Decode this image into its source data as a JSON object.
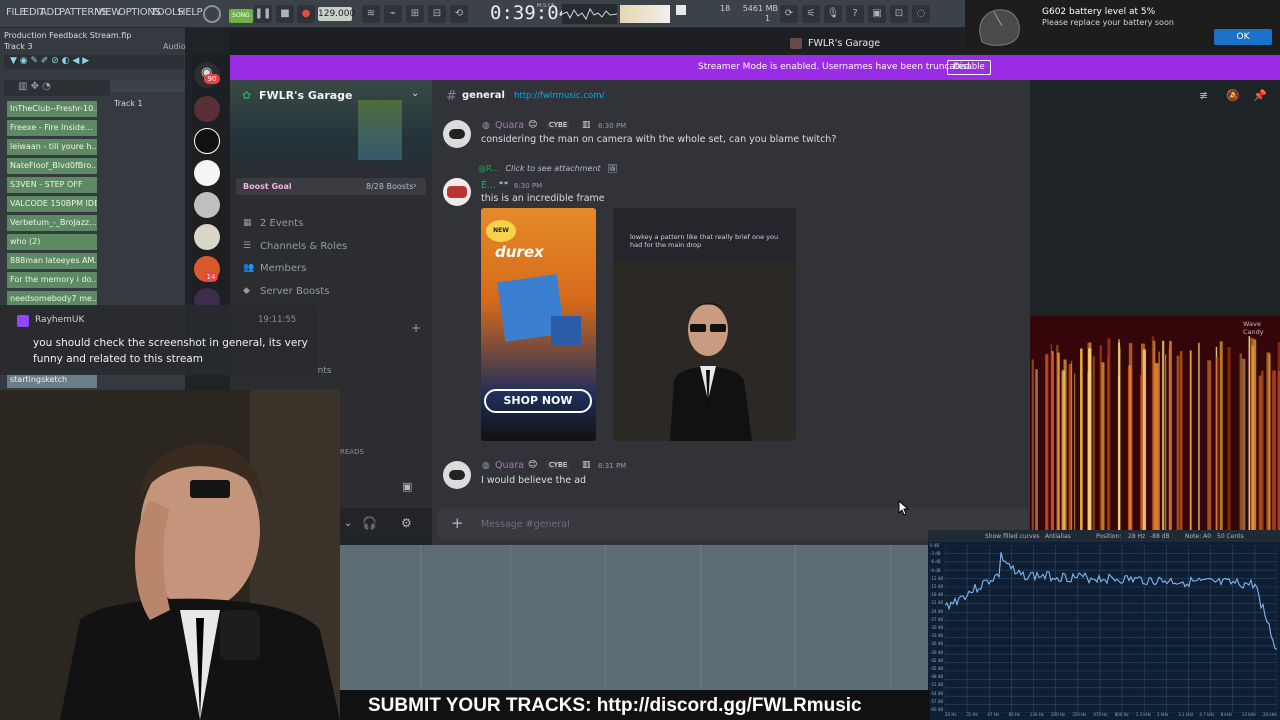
{
  "fl": {
    "menu": [
      "FILE",
      "EDIT",
      "ADD",
      "PATTERNS",
      "VIEW",
      "OPTIONS",
      "TOOLS",
      "HELP"
    ],
    "song_label": "SONG",
    "bpm": "129.000",
    "time": "0:39:04",
    "time_label": "M:S:CS",
    "cpu": "18",
    "mem": "5461 MB",
    "mem_sub": "1",
    "project_title": "Production Feedback Stream.flp",
    "track_label": "Track 3",
    "audio_label": "Audio",
    "playlist_track": "Track 1",
    "browser_items": [
      "InTheClub--Freshr-10...",
      "Freexe - Fire Inside...",
      "leiwaan - till youre h...",
      "NateFloof_Blvd0fBro...",
      "S3VEN - STEP OFF",
      "VALCODE 150BPM IDB...",
      "Verbetum_-_BroJazz...",
      "who (2)",
      "888man lateeyes AM...",
      "For the memory i do...",
      "needsomebody7 me...",
      "startingsketch"
    ]
  },
  "notification": {
    "title": "G602 battery level at 5%",
    "body": "Please replace your battery soon",
    "ok_label": "OK"
  },
  "discord": {
    "window_title": "FWLR's Garage",
    "streamer_banner": "Streamer Mode is enabled. Usernames have been truncated.",
    "disable_label": "Disable",
    "server_name": "FWLR's Garage",
    "boost_goal": "Boost Goal",
    "boost_count": "8/28 Boosts",
    "sidebar_items": [
      "2 Events",
      "Channels & Roles",
      "Members",
      "Server Boosts"
    ],
    "sidebar_partial": "ents",
    "threads_partial": "READS",
    "server_badges": [
      "90",
      "14"
    ],
    "channel": {
      "name": "general",
      "topic": "http://fwlrmusic.com/"
    },
    "messages": [
      {
        "user": "Quara",
        "tag": "CYBE",
        "time": "6:30 PM",
        "text": "considering the man on camera with the whole set, can you blame twitch?"
      },
      {
        "reply_user": "@R...",
        "reply_text": "Click to see attachment",
        "user": "É...",
        "time": "6:30 PM",
        "text": "this is an incredible frame"
      },
      {
        "user": "Quara",
        "tag": "CYBE",
        "time": "6:31 PM",
        "text": "I would believe the ad"
      }
    ],
    "attachment": {
      "badge": "NEW",
      "brand": "durex",
      "cta": "SHOP NOW",
      "caption": "lowkey a pattern like that really brief one you had for the main drop"
    },
    "input_placeholder": "Message #general"
  },
  "twitch": {
    "user": "RayhemUK",
    "time": "19:11:55",
    "message": "you should check the screenshot in general, its very funny and related to this stream"
  },
  "spectrogram": {
    "title": "Wave Candy",
    "toolbar": [
      "Show filled curves",
      "Antialias",
      "Position:",
      "28 Hz",
      "-88 dB",
      "Note: A0",
      "50 Cents"
    ]
  },
  "analyzer": {
    "db_labels": [
      "0 dB",
      "-3 dB",
      "-6 dB",
      "-9 dB",
      "-12 dB",
      "-15 dB",
      "-18 dB",
      "-21 dB",
      "-24 dB",
      "-27 dB",
      "-30 dB",
      "-33 dB",
      "-36 dB",
      "-39 dB",
      "-42 dB",
      "-45 dB",
      "-48 dB",
      "-51 dB",
      "-54 dB",
      "-57 dB",
      "-60 dB"
    ],
    "freq_labels": [
      "20 Hz",
      "31 Hz",
      "47 Hz",
      "80 Hz",
      "130 Hz",
      "200 Hz",
      "310 Hz",
      "470 Hz",
      "800 Hz",
      "1.3 kHz",
      "2 kHz",
      "3.1 kHz",
      "4.7 kHz",
      "8 kHz",
      "13 kHz",
      "20 kHz"
    ]
  },
  "overlay": {
    "bottom_banner": "SUBMIT YOUR TRACKS: http://discord.gg/FWLRmusic"
  },
  "colors": {
    "streamer_purple": "#9b2ce6",
    "fl_browser_green": "#5e8a63",
    "discord_bg": "#313338",
    "link_blue": "#00a8fc",
    "twitch_purple": "#9146ff",
    "notif_ok_blue": "#1a73c8"
  }
}
